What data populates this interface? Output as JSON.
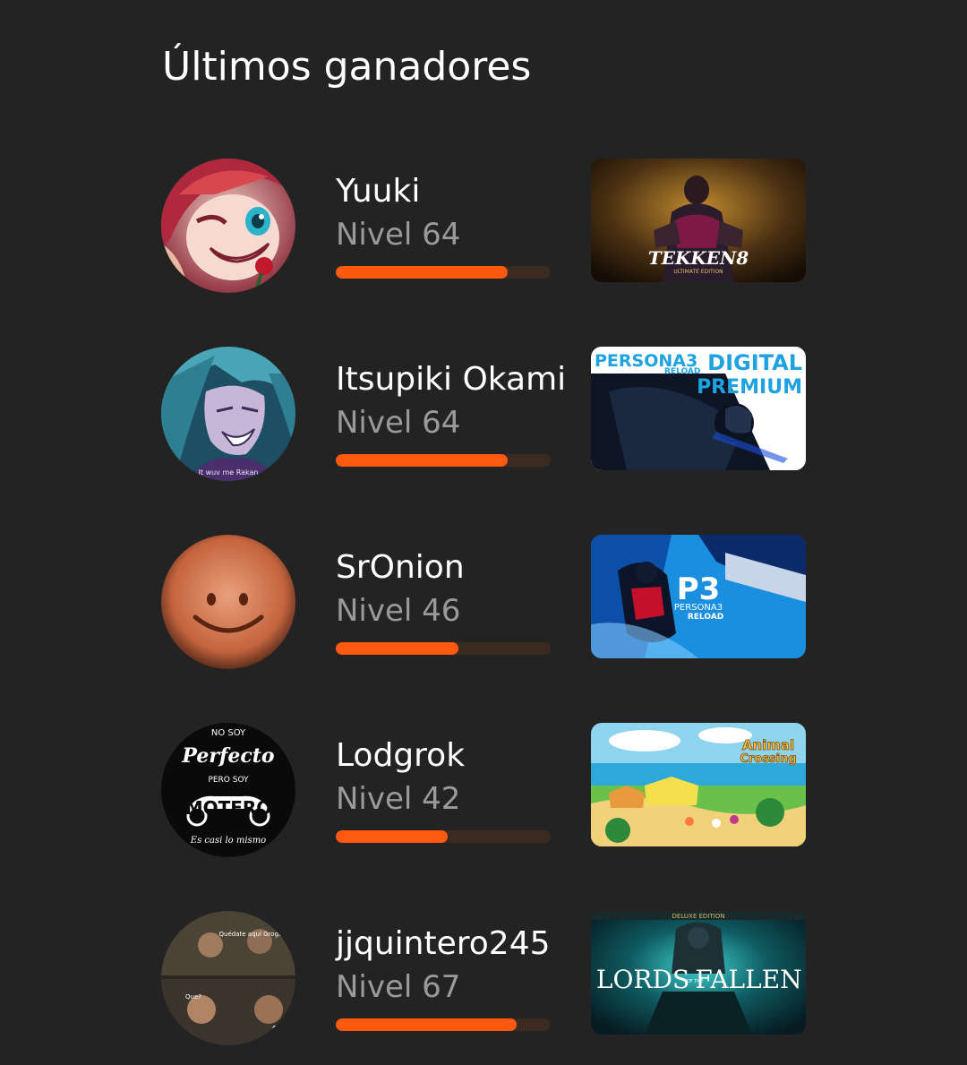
{
  "section": {
    "title": "Últimos ganadores"
  },
  "winners": [
    {
      "name": "Yuuki",
      "level": "Nivel 64",
      "progress": 0.8,
      "avatar_icon": "chibi-character-avatar",
      "prize": {
        "logo_text": "TEKKEN8",
        "sub_text": "ULTIMATE EDITION"
      }
    },
    {
      "name": "Itsupiki Okami",
      "level": "Nivel 64",
      "progress": 0.8,
      "avatar_icon": "anime-villain-avatar",
      "prize": {
        "logo_text": "PERSONA3",
        "sub_logo": "RELOAD",
        "edition_a": "DIGITAL",
        "edition_b": "PREMIUM"
      }
    },
    {
      "name": "SrOnion",
      "level": "Nivel 46",
      "progress": 0.57,
      "avatar_icon": "smiling-face-avatar",
      "prize": {
        "logo_text": "P3",
        "sub_logo": "PERSONA3",
        "sub_logo_2": "RELOAD"
      }
    },
    {
      "name": "Lodgrok",
      "level": "Nivel 42",
      "progress": 0.52,
      "avatar_icon": "motorcycle-badge-avatar",
      "avatar_text": {
        "line1": "NO SOY",
        "line2": "Perfecto",
        "line3": "PERO SOY",
        "line4": "MOTERO",
        "line5": "Es casi lo mismo"
      },
      "prize": {
        "logo_a": "Animal",
        "logo_b": "Crossing"
      }
    },
    {
      "name": "jjquintero245",
      "level": "Nivel 67",
      "progress": 0.84,
      "avatar_icon": "meme-collage-avatar",
      "avatar_text": {
        "caption1": "Quédate aquí Grogu",
        "caption2": "Que?",
        "caption3": "Que"
      },
      "prize": {
        "edition": "DELUXE EDITION",
        "logo_a": "LORDS",
        "logo_of": "OF THE",
        "logo_b": "FALLEN"
      }
    }
  ],
  "colors": {
    "background": "#232323",
    "accent": "#ff5a10",
    "bar_track": "#3b2a22",
    "level_text": "#9a9a9a"
  }
}
